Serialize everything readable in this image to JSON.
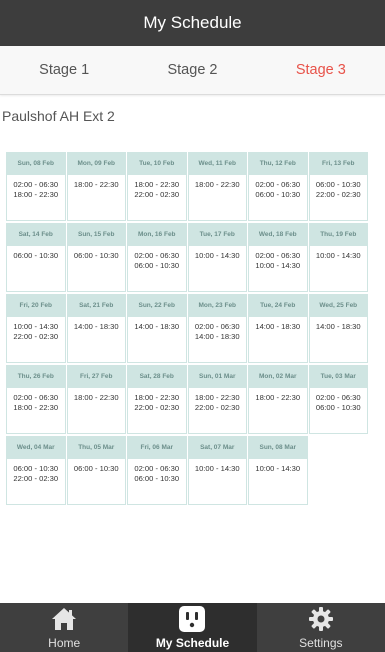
{
  "header": {
    "title": "My Schedule"
  },
  "stages": {
    "items": [
      {
        "label": "Stage 1"
      },
      {
        "label": "Stage 2"
      },
      {
        "label": "Stage 3"
      }
    ],
    "active_index": 2
  },
  "area": {
    "name": "Paulshof AH Ext 2"
  },
  "schedule": [
    {
      "date": "Sun, 08 Feb",
      "slots": [
        "02:00 - 06:30",
        "18:00 - 22:30"
      ]
    },
    {
      "date": "Mon, 09 Feb",
      "slots": [
        "18:00 - 22:30"
      ]
    },
    {
      "date": "Tue, 10 Feb",
      "slots": [
        "18:00 - 22:30",
        "22:00 - 02:30"
      ]
    },
    {
      "date": "Wed, 11 Feb",
      "slots": [
        "18:00 - 22:30"
      ]
    },
    {
      "date": "Thu, 12 Feb",
      "slots": [
        "02:00 - 06:30",
        "06:00 - 10:30"
      ]
    },
    {
      "date": "Fri, 13 Feb",
      "slots": [
        "06:00 - 10:30",
        "22:00 - 02:30"
      ]
    },
    {
      "date": "Sat, 14 Feb",
      "slots": [
        "06:00 - 10:30"
      ]
    },
    {
      "date": "Sun, 15 Feb",
      "slots": [
        "06:00 - 10:30"
      ]
    },
    {
      "date": "Mon, 16 Feb",
      "slots": [
        "02:00 - 06:30",
        "06:00 - 10:30"
      ]
    },
    {
      "date": "Tue, 17 Feb",
      "slots": [
        "10:00 - 14:30"
      ]
    },
    {
      "date": "Wed, 18 Feb",
      "slots": [
        "02:00 - 06:30",
        "10:00 - 14:30"
      ]
    },
    {
      "date": "Thu, 19 Feb",
      "slots": [
        "10:00 - 14:30"
      ]
    },
    {
      "date": "Fri, 20 Feb",
      "slots": [
        "10:00 - 14:30",
        "22:00 - 02:30"
      ]
    },
    {
      "date": "Sat, 21 Feb",
      "slots": [
        "14:00 - 18:30"
      ]
    },
    {
      "date": "Sun, 22 Feb",
      "slots": [
        "14:00 - 18:30"
      ]
    },
    {
      "date": "Mon, 23 Feb",
      "slots": [
        "02:00 - 06:30",
        "14:00 - 18:30"
      ]
    },
    {
      "date": "Tue, 24 Feb",
      "slots": [
        "14:00 - 18:30"
      ]
    },
    {
      "date": "Wed, 25 Feb",
      "slots": [
        "14:00 - 18:30"
      ]
    },
    {
      "date": "Thu, 26 Feb",
      "slots": [
        "02:00 - 06:30",
        "18:00 - 22:30"
      ]
    },
    {
      "date": "Fri, 27 Feb",
      "slots": [
        "18:00 - 22:30"
      ]
    },
    {
      "date": "Sat, 28 Feb",
      "slots": [
        "18:00 - 22:30",
        "22:00 - 02:30"
      ]
    },
    {
      "date": "Sun, 01 Mar",
      "slots": [
        "18:00 - 22:30",
        "22:00 - 02:30"
      ]
    },
    {
      "date": "Mon, 02 Mar",
      "slots": [
        "18:00 - 22:30"
      ]
    },
    {
      "date": "Tue, 03 Mar",
      "slots": [
        "02:00 - 06:30",
        "06:00 - 10:30"
      ]
    },
    {
      "date": "Wed, 04 Mar",
      "slots": [
        "06:00 - 10:30",
        "22:00 - 02:30"
      ]
    },
    {
      "date": "Thu, 05 Mar",
      "slots": [
        "06:00 - 10:30"
      ]
    },
    {
      "date": "Fri, 06 Mar",
      "slots": [
        "02:00 - 06:30",
        "06:00 - 10:30"
      ]
    },
    {
      "date": "Sat, 07 Mar",
      "slots": [
        "10:00 - 14:30"
      ]
    },
    {
      "date": "Sun, 08 Mar",
      "slots": [
        "10:00 - 14:30"
      ]
    }
  ],
  "nav": {
    "items": [
      {
        "label": "Home",
        "icon": "home-icon"
      },
      {
        "label": "My Schedule",
        "icon": "power-socket-icon"
      },
      {
        "label": "Settings",
        "icon": "gear-icon"
      }
    ],
    "active_index": 1
  },
  "colors": {
    "header_bg": "#3d3d3d",
    "active_tab": "#e8534a",
    "cell_header_bg": "#cfe5e2",
    "cell_header_text": "#6c8f8b",
    "nav_bg": "#3f3f3f"
  }
}
